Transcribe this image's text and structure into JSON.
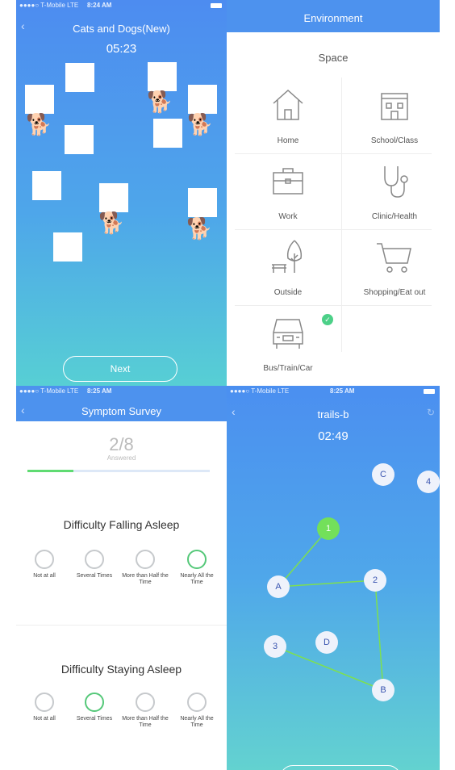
{
  "status_p1": {
    "carrier": "●●●●○ T-Mobile  LTE",
    "time": "8:24 AM"
  },
  "status_p3": {
    "carrier": "●●●●○ T-Mobile  LTE",
    "time": "8:25 AM"
  },
  "status_p4": {
    "carrier": "●●●●○ T-Mobile  LTE",
    "time": "8:25 AM"
  },
  "cats": {
    "title": "Cats and Dogs(New)",
    "timer": "05:23",
    "next": "Next"
  },
  "env": {
    "title": "Environment",
    "section": "Space",
    "items": [
      {
        "label": "Home",
        "icon": "house-icon"
      },
      {
        "label": "School/Class",
        "icon": "school-icon"
      },
      {
        "label": "Work",
        "icon": "briefcase-icon"
      },
      {
        "label": "Clinic/Health",
        "icon": "stethoscope-icon"
      },
      {
        "label": "Outside",
        "icon": "tree-bench-icon"
      },
      {
        "label": "Shopping/Eat out",
        "icon": "cart-icon"
      },
      {
        "label": "Bus/Train/Car",
        "icon": "car-icon",
        "selected": true
      }
    ]
  },
  "survey": {
    "title": "Symptom Survey",
    "count": "2/8",
    "answered": "Answered",
    "progress": 0.25,
    "q1": {
      "text": "Difficulty Falling Asleep",
      "selected": 3
    },
    "q2": {
      "text": "Difficulty Staying Asleep",
      "selected": 1
    },
    "options": [
      "Not at all",
      "Several Times",
      "More than Half the Time",
      "Nearly All the Time"
    ]
  },
  "trails": {
    "title": "trails-b",
    "timer": "02:49",
    "nodes": [
      "C",
      "4",
      "1",
      "A",
      "2",
      "D",
      "3",
      "B"
    ]
  },
  "colors": {
    "accent": "#4d92ee",
    "check": "#4cd088",
    "selected_ring": "#55c879",
    "trail_line": "#7ee04e"
  }
}
